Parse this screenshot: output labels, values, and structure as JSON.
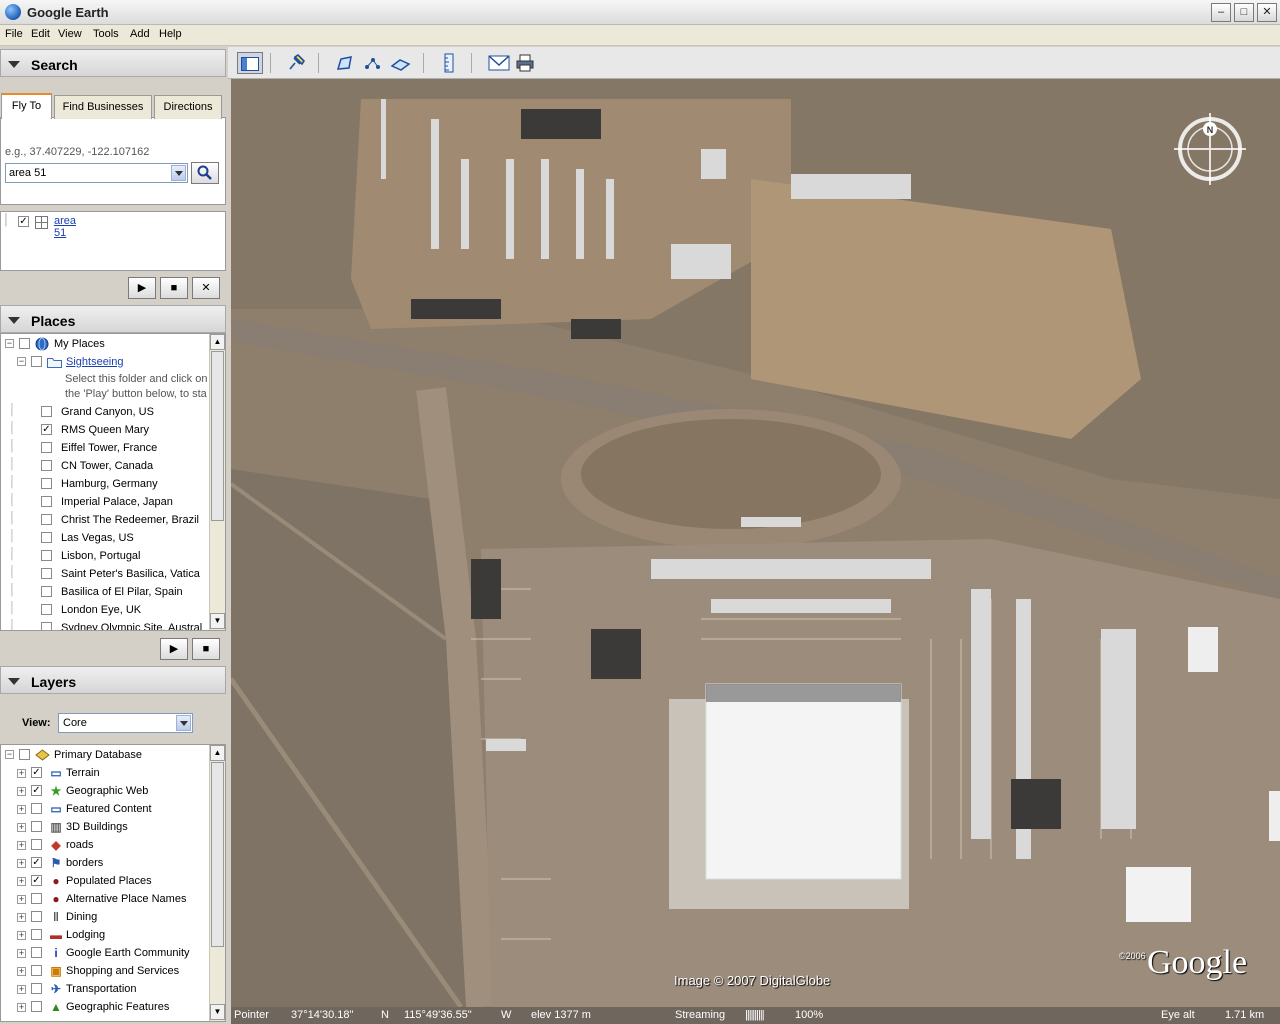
{
  "window": {
    "title": "Google Earth",
    "minimize": "–",
    "maximize": "□",
    "close": "✕"
  },
  "menu": [
    "File",
    "Edit",
    "View",
    "Tools",
    "Add",
    "Help"
  ],
  "search": {
    "header": "Search",
    "tabs": [
      "Fly To",
      "Find Businesses",
      "Directions"
    ],
    "hint": "e.g., 37.407229, -122.107162",
    "query": "area 51",
    "result": "area 51"
  },
  "places": {
    "header": "Places",
    "root": "My Places",
    "folder": "Sightseeing",
    "folder_desc_1": "Select this folder and click on",
    "folder_desc_2": "the 'Play' button below, to sta",
    "items": [
      {
        "label": "Grand Canyon, US",
        "checked": false
      },
      {
        "label": "RMS Queen Mary",
        "checked": true
      },
      {
        "label": "Eiffel Tower, France",
        "checked": false
      },
      {
        "label": "CN Tower, Canada",
        "checked": false
      },
      {
        "label": "Hamburg, Germany",
        "checked": false
      },
      {
        "label": "Imperial Palace, Japan",
        "checked": false
      },
      {
        "label": "Christ The Redeemer, Brazil",
        "checked": false
      },
      {
        "label": "Las Vegas, US",
        "checked": false
      },
      {
        "label": "Lisbon, Portugal",
        "checked": false
      },
      {
        "label": "Saint Peter's Basilica, Vatica",
        "checked": false
      },
      {
        "label": "Basilica of El Pilar, Spain",
        "checked": false
      },
      {
        "label": "London Eye, UK",
        "checked": false
      },
      {
        "label": "Sydney Olympic Site, Austral",
        "checked": false
      }
    ]
  },
  "layers": {
    "header": "Layers",
    "view_label": "View:",
    "view_value": "Core",
    "root": "Primary Database",
    "items": [
      {
        "label": "Terrain",
        "checked": true,
        "icon": "folder-icon",
        "color": "#2a5db0"
      },
      {
        "label": "Geographic Web",
        "checked": true,
        "icon": "star-icon",
        "color": "#3a9a2a"
      },
      {
        "label": "Featured Content",
        "checked": false,
        "icon": "folder-icon",
        "color": "#2a5db0"
      },
      {
        "label": "3D Buildings",
        "checked": false,
        "icon": "building-icon",
        "color": "#666666"
      },
      {
        "label": "roads",
        "checked": false,
        "icon": "shield-icon",
        "color": "#c0392b"
      },
      {
        "label": "borders",
        "checked": true,
        "icon": "flag-icon",
        "color": "#2a5db0"
      },
      {
        "label": "Populated Places",
        "checked": true,
        "icon": "dot-icon",
        "color": "#8b1a1a"
      },
      {
        "label": "Alternative Place Names",
        "checked": false,
        "icon": "dot-icon",
        "color": "#8b1a1a"
      },
      {
        "label": "Dining",
        "checked": false,
        "icon": "fork-icon",
        "color": "#555555"
      },
      {
        "label": "Lodging",
        "checked": false,
        "icon": "bed-icon",
        "color": "#b03030"
      },
      {
        "label": "Google Earth Community",
        "checked": false,
        "icon": "info-icon",
        "color": "#1a3fb0"
      },
      {
        "label": "Shopping and Services",
        "checked": false,
        "icon": "cart-icon",
        "color": "#cc7a00"
      },
      {
        "label": "Transportation",
        "checked": false,
        "icon": "plane-icon",
        "color": "#2a5db0"
      },
      {
        "label": "Geographic Features",
        "checked": false,
        "icon": "mountain-icon",
        "color": "#2a8a2a"
      }
    ]
  },
  "map": {
    "copyright": "Image © 2007 DigitalGlobe",
    "logo_year": "©2006",
    "logo": "Google",
    "compass_label": "N"
  },
  "status": {
    "pointer_label": "Pointer",
    "lat": "37°14'30.18\"",
    "lat_hemi": "N",
    "lon": "115°49'36.55\"",
    "lon_hemi": "W",
    "elev": "elev 1377 m",
    "streaming_label": "Streaming",
    "streaming_bar": "||||||||||",
    "streaming_pct": "100%",
    "eye_label": "Eye alt",
    "eye_value": "1.71 km"
  }
}
